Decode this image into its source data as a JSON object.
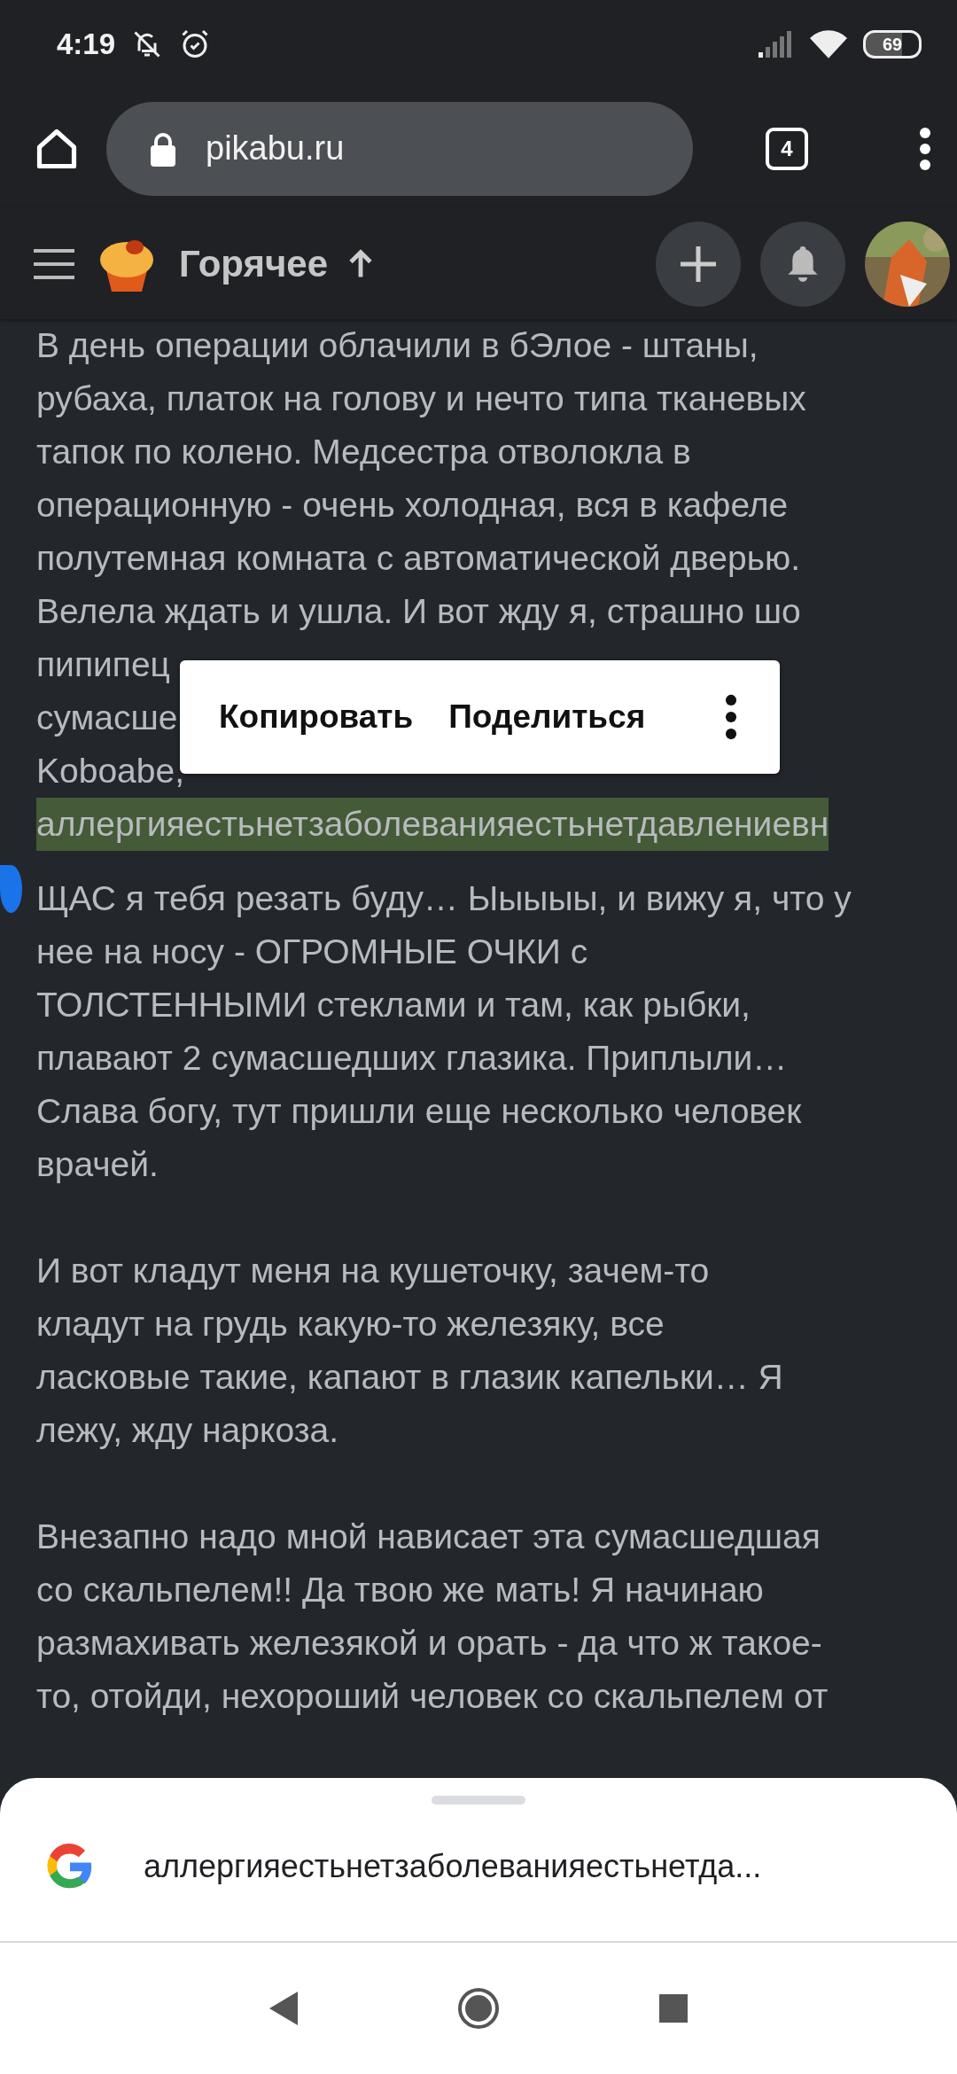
{
  "status_bar": {
    "time": "4:19",
    "battery": "69"
  },
  "browser": {
    "url": "pikabu.ru",
    "tab_count": "4"
  },
  "site_header": {
    "title": "Горячее"
  },
  "article": {
    "paragraphs": [
      {
        "lines": [
          {
            "text": "В день операции облачили в бЭлое - штаны,",
            "selected": false
          },
          {
            "text": "рубаха, платок на голову и нечто типа тканевых",
            "selected": false
          },
          {
            "text": "тапок по колено. Медсестра отволокла в",
            "selected": false
          },
          {
            "text": "операционную - очень холодная, вся в кафеле",
            "selected": false
          },
          {
            "text": "полутемная комната с автоматической дверью.",
            "selected": false
          },
          {
            "text": "Велела ждать и ушла. И вот жду я, страшно шо",
            "selected": false
          },
          {
            "text": "пипипец",
            "selected": false
          },
          {
            "text": "сумасше",
            "selected": false
          },
          {
            "text": "Koboabe,",
            "selected": false
          },
          {
            "text": "аллергияестьнетзаболеванияестьнетдавлениевн",
            "selected": true
          },
          {
            "text": "ЩАС я тебя резать буду… Ыыыыы, и вижу я, что у",
            "selected": false
          },
          {
            "text": "нее на носу - ОГРОМНЫЕ ОЧКИ с",
            "selected": false
          },
          {
            "text": "ТОЛСТЕННЫМИ стеклами и там, как рыбки,",
            "selected": false
          },
          {
            "text": "плавают 2 сумасшедших глазика. Приплыли…",
            "selected": false
          },
          {
            "text": "Слава богу, тут пришли еще несколько человек",
            "selected": false
          },
          {
            "text": "врачей.",
            "selected": false
          }
        ]
      },
      {
        "lines": [
          {
            "text": "И вот кладут меня на кушеточку, зачем-то",
            "selected": false
          },
          {
            "text": "кладут на грудь какую-то железяку, все",
            "selected": false
          },
          {
            "text": "ласковые такие, капают в глазик капельки… Я",
            "selected": false
          },
          {
            "text": "лежу, жду наркоза.",
            "selected": false
          }
        ]
      },
      {
        "lines": [
          {
            "text": "Внезапно надо мной нависает эта сумасшедшая",
            "selected": false
          },
          {
            "text": "со скальпелем!! Да твою же мать! Я начинаю",
            "selected": false
          },
          {
            "text": "размахивать железякой и орать - да что ж такое-",
            "selected": false
          },
          {
            "text": "то, отойди, нехороший человек со скальпелем от",
            "selected": false
          }
        ]
      }
    ]
  },
  "context_menu": {
    "items": [
      "Копировать",
      "Поделиться"
    ]
  },
  "search_sheet": {
    "query": "аллергияестьнетзаболеванияестьнетда..."
  }
}
